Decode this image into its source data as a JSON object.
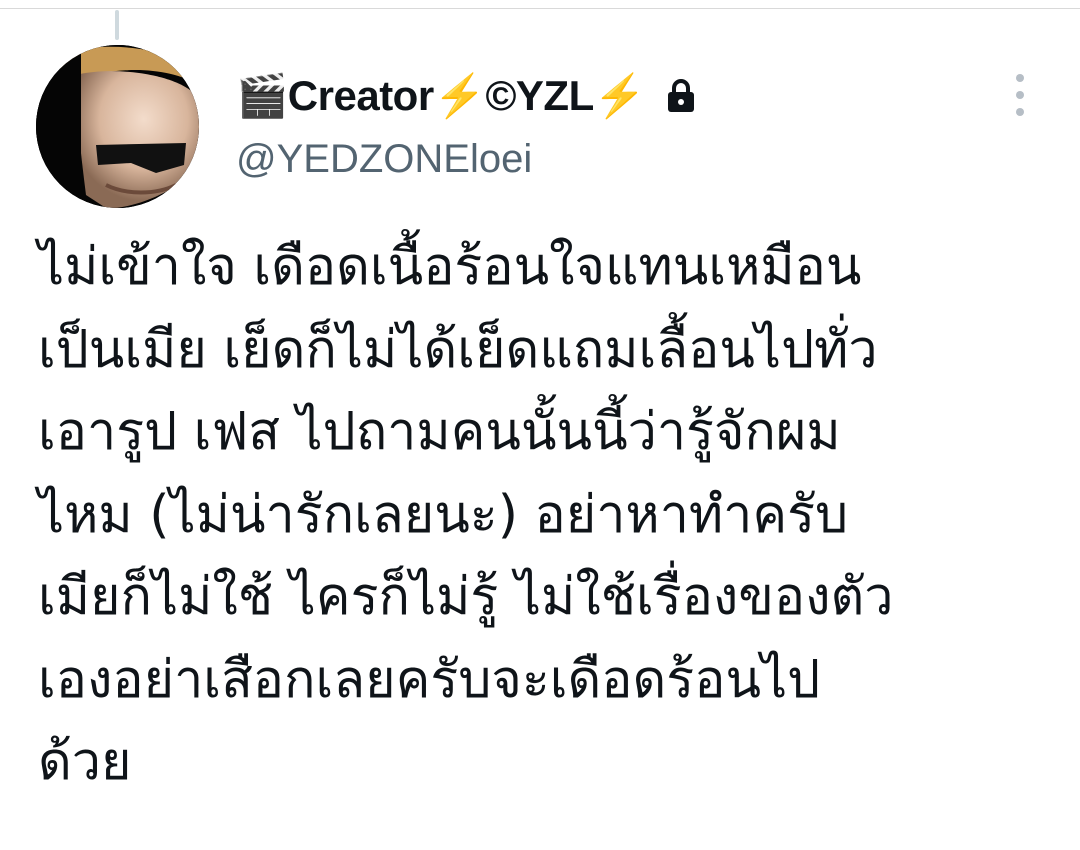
{
  "author": {
    "display_name": "🎬Creator⚡©YZL⚡",
    "handle": "@YEDZONEloei",
    "icons": {
      "lock": "lock-icon",
      "more": "more-vertical-icon",
      "avatar": "avatar-photo"
    }
  },
  "tweet": {
    "lines": [
      "ไม่เข้าใจ เดือดเนื้อร้อนใจแทนเหมือน",
      "เป็นเมีย เย็ดก็ไม่ได้เย็ดแถมเลื้อนไปทั่ว",
      "เอารูป เฟส ไปถามคนนั้นนี้ว่ารู้จักผม",
      "ไหม (ไม่น่ารักเลยนะ) อย่าหาทำครับ",
      "เมียก็ไม่ใช้ ไครก็ไม่รู้ ไม่ใช้เรื่องของตัว",
      "เองอย่าเสือกเลยครับจะเดือดร้อนไป",
      "ด้วย"
    ]
  },
  "meta": {
    "time": "",
    "source": ""
  },
  "colors": {
    "text": "#0f1419",
    "secondary": "#536471",
    "link": "#1d9bf0",
    "icon_muted": "#b6bec6"
  }
}
